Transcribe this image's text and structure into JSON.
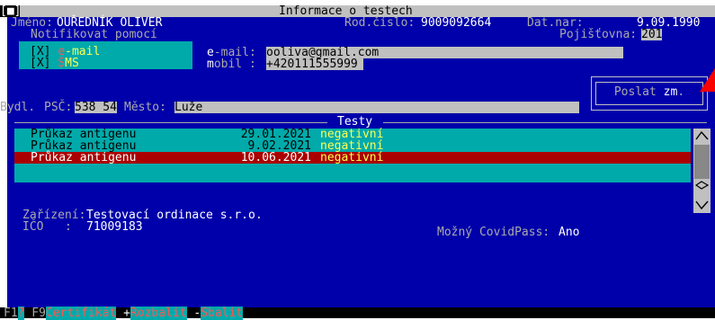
{
  "title": "Informace o testech",
  "patient": {
    "name_label": "Jméno:",
    "name_value": "OUŘEDNÍK OLIVER",
    "birth_number_label": "Rod.číslo:",
    "birth_number_value": "9009092664",
    "birth_date_label": "Dat.nar:",
    "birth_date_value": "9.09.1990",
    "notify_label": "Notifikovat pomocí",
    "insurer_label": "Pojišťovna:",
    "insurer_value": "201"
  },
  "notify": {
    "email_check": "[X]",
    "email_first": "e",
    "email_rest": "-mail",
    "sms_check": "[X]",
    "sms_first": "S",
    "sms_rest": "MS",
    "email_field_label_first": "e",
    "email_field_label_rest": "-mail:",
    "email_value": "ooliva@gmail.com",
    "mobile_field_label_first": "m",
    "mobile_field_label_rest": "obil :",
    "mobile_value": "+420111555999"
  },
  "send_button": {
    "text": "Poslat ",
    "hot": "zm",
    "tail": "."
  },
  "address": {
    "prefix": "Bydl. ",
    "psc_label": "PSČ:",
    "psc_value": "538 54",
    "city_label": "Město:",
    "city_value": "Luže"
  },
  "tests_header": "Testy",
  "tests": [
    {
      "type": "Průkaz antigenu",
      "date": "29.01.2021",
      "result": "negativní",
      "selected": false
    },
    {
      "type": "Průkaz antigenu",
      "date": "9.02.2021",
      "result": "negativní",
      "selected": false
    },
    {
      "type": "Průkaz antigenu",
      "date": "10.06.2021",
      "result": "negativní",
      "selected": true
    }
  ],
  "facility": {
    "label": "Zařízení:",
    "value": "Testovací ordinace s.r.o.",
    "ico_label": "IČO   :",
    "ico_value": "71009183",
    "covidpass_label": "Možný CovidPass:",
    "covidpass_value": "Ano"
  },
  "statusbar": {
    "k1": "F1",
    "k1_sym": "?",
    "k2": " F9",
    "k2_label": "Certifikát",
    "k3": " +",
    "k3_label": "Rozbalit",
    "k4": " -",
    "k4_label": "Sbalit"
  },
  "colors": {
    "window_bg": "#0000aa",
    "list_bg": "#00aaaa",
    "selected_row": "#aa0000",
    "accent": "#ffff55",
    "arrow": "#ff0000"
  }
}
